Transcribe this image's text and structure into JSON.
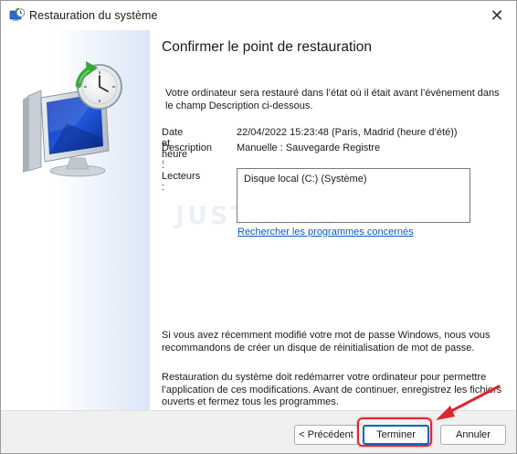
{
  "window": {
    "title": "Restauration du système",
    "close_glyph": "✕"
  },
  "icons": {
    "app": "system-restore-icon",
    "illustration": "monitor-restore-clock-icon",
    "close": "close-icon"
  },
  "main": {
    "heading": "Confirmer le point de restauration",
    "intro": "Votre ordinateur sera restauré dans l’état où il était avant l’événement dans le champ Description ci-dessous.",
    "date_label": "Date et heure :",
    "date_value": "22/04/2022 15:23:48 (Paris, Madrid (heure d’été))",
    "description_label": "Description :",
    "description_value": "Manuelle : Sauvegarde Registre",
    "drives_label": "Lecteurs :",
    "drives": [
      "Disque local (C:) (Système)"
    ],
    "programs_link": "Rechercher les programmes concernés",
    "password_note": "Si vous avez récemment modifié votre mot de passe Windows, nous vous recommandons de créer un disque de réinitialisation de mot de passe.",
    "restart_note": "Restauration du système doit redémarrer votre ordinateur pour permettre l’application de ces modifications. Avant de continuer, enregistrez les fichiers ouverts et fermez tous les programmes.",
    "watermark": "JUSTGEEK"
  },
  "footer": {
    "previous_label": "< Précédent",
    "finish_label": "Terminer",
    "cancel_label": "Annuler"
  },
  "colors": {
    "accent": "#0067c0",
    "link": "#0a5bc4",
    "highlight": "#e0262d"
  }
}
